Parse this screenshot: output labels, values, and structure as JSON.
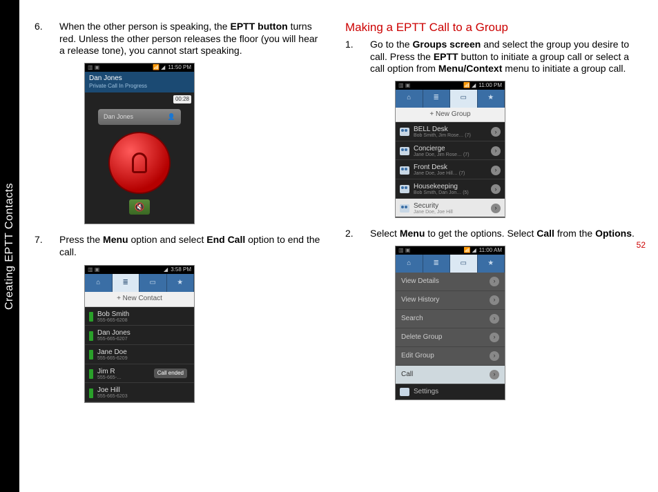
{
  "sidebar_label": "Creating EPTT Contacts",
  "page_number": "52",
  "left": {
    "step6": {
      "num": "6.",
      "text_a": "When the other person is speaking, the ",
      "bold_a": "EPTT button",
      "text_b": " turns red. Unless the other person releases the floor (you will hear a release tone), you cannot start speaking."
    },
    "step7": {
      "num": "7.",
      "text_a": "Press the ",
      "bold_a": "Menu",
      "text_b": " option and select ",
      "bold_b": "End Call",
      "text_c": " option to end the call."
    }
  },
  "right": {
    "heading": "Making a EPTT Call to a Group",
    "step1": {
      "num": "1.",
      "text_a": "Go to the ",
      "bold_a": "Groups screen",
      "text_b": " and select the group you desire to call. Press the ",
      "bold_b": "EPTT",
      "text_c": " button to initiate a group call or select a call option from ",
      "bold_c": "Menu/Context",
      "text_d": " menu to initiate a group call."
    },
    "step2": {
      "num": "2.",
      "text_a": "Select ",
      "bold_a": "Menu",
      "text_b": " to get the options. Select ",
      "bold_b": "Call",
      "text_c": " from the ",
      "bold_c": "Options",
      "text_d": "."
    }
  },
  "shot1": {
    "time": "11:50 PM",
    "title": "Dan Jones",
    "subtitle": "Private Call In Progress",
    "timer": "00:28",
    "speaker": "Dan Jones",
    "speaker_icon_label": "👤"
  },
  "shot2": {
    "time": "3:58 PM",
    "newbtn": "+ New Contact",
    "rows": [
      {
        "name": "Bob Smith",
        "sub": "555-665-6208"
      },
      {
        "name": "Dan Jones",
        "sub": "555-665-6207"
      },
      {
        "name": "Jane Doe",
        "sub": "555-665-6209"
      },
      {
        "name": "Jim R",
        "sub": "555-665-…"
      },
      {
        "name": "Joe Hill",
        "sub": "555-665-6203"
      }
    ],
    "tooltip": "Call ended"
  },
  "shot3": {
    "time": "11:00 PM",
    "newbtn": "+ New Group",
    "rows": [
      {
        "name": "BELL Desk",
        "sub": "Bob Smith, Jim Rose… (7)"
      },
      {
        "name": "Concierge",
        "sub": "Jane Doe, Jim Rose… (7)"
      },
      {
        "name": "Front Desk",
        "sub": "Jane Doe, Joe Hill… (7)"
      },
      {
        "name": "Housekeeping",
        "sub": "Bob Smith, Dan Jon… (5)"
      },
      {
        "name": "Security",
        "sub": "Jane Doe, Joe Hill"
      }
    ]
  },
  "shot4": {
    "time": "11:00 AM",
    "menu": [
      "View Details",
      "View History",
      "Search",
      "Delete Group",
      "Edit Group",
      "Call"
    ],
    "footer": "Settings"
  },
  "icons": {
    "home": "⌂",
    "list": "≣",
    "card": "▭",
    "star": "★",
    "speaker": "🔇",
    "chev": "›"
  }
}
